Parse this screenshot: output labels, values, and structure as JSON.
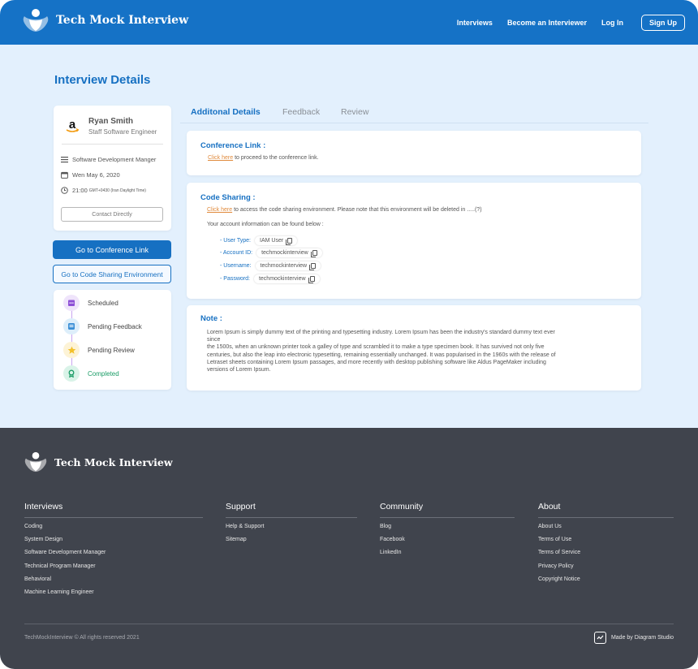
{
  "app": {
    "brand": "Tech Mock Interview"
  },
  "nav": {
    "items": [
      "Interviews",
      "Become an Interviewer",
      "Log In"
    ],
    "signup": "Sign Up"
  },
  "page": {
    "title": "Interview Details"
  },
  "profile": {
    "name": "Ryan Smith",
    "role": "Staff Software Engineer",
    "position": "Software Development Manger",
    "date": "Wen May 6, 2020",
    "time": "21:00",
    "timezone": "GMT+0430 (Iran Daylight Time)",
    "contact": "Contact Directly"
  },
  "actions": {
    "conference": "Go to Conference Link",
    "code": "Go to Code Sharing Environment"
  },
  "status": [
    {
      "label": "Scheduled",
      "color": "#8d4fd6",
      "bg": "#efe4fb"
    },
    {
      "label": "Pending Feedback",
      "color": "#3b8fd6",
      "bg": "#ddeefa"
    },
    {
      "label": "Pending Review",
      "color": "#f3c12b",
      "bg": "#fdf3d6"
    },
    {
      "label": "Completed",
      "color": "#1a9c66",
      "bg": "#d9f3e8",
      "highlight": true
    }
  ],
  "tabs": [
    "Additonal Details",
    "Feedback",
    "Review"
  ],
  "conference": {
    "title": "Conference Link :",
    "link": "Click here",
    "text": "to proceed to the conference link."
  },
  "code": {
    "title": "Code Sharing :",
    "link": "Click here",
    "text": "to access the code sharing environment. Please note that this environment will be deleted in .....(?)",
    "account_text": "Your account information can be found below :",
    "fields": [
      {
        "key": "- User Type:",
        "value": "IAM User"
      },
      {
        "key": "- Account ID:",
        "value": "techmockinterview"
      },
      {
        "key": "- Username:",
        "value": "techmockinterview"
      },
      {
        "key": "- Password:",
        "value": "techmockinterview"
      }
    ]
  },
  "note": {
    "title": "Note :",
    "lines": [
      "Lorem Ipsum is simply dummy text of the printing and typesetting industry. Lorem Ipsum has been the industry's standard dummy text ever",
      "since",
      "the 1500s, when an unknown printer took a galley of type and scrambled it to make a type specimen book. It has survived not only five",
      "centuries, but also the leap into electronic typesetting, remaining essentially unchanged. It was popularised in the 1960s with the release of",
      "Letraset sheets containing Lorem Ipsum passages, and more recently with desktop publishing software like Aldus PageMaker including",
      "versions of Lorem Ipsum."
    ]
  },
  "footer": {
    "brand": "Tech Mock Interview",
    "columns": [
      {
        "title": "Interviews",
        "links": [
          "Coding",
          "System Design",
          "Software Development Manager",
          "Technical Program Manager",
          "Behavioral",
          "Machine Learning Engineer"
        ]
      },
      {
        "title": "Support",
        "links": [
          "Help & Support",
          "Sitemap"
        ]
      },
      {
        "title": "Community",
        "links": [
          "Blog",
          "Facebook",
          "LinkedIn"
        ]
      },
      {
        "title": "About",
        "links": [
          "About Us",
          "Terms of Use",
          "Terms of Service",
          "Privacy Policy",
          "Copyright Notice"
        ]
      }
    ],
    "copyright": "TechMockInterview © All rights reserved 2021",
    "made_by": "Made by Diagram Studio"
  },
  "colors": {
    "brand_blue": "#1670c2",
    "header_blue": "#1572c6",
    "footer_bg": "#40444d",
    "page_bg": "#e3f0fd",
    "link_orange": "#e08a3c"
  }
}
